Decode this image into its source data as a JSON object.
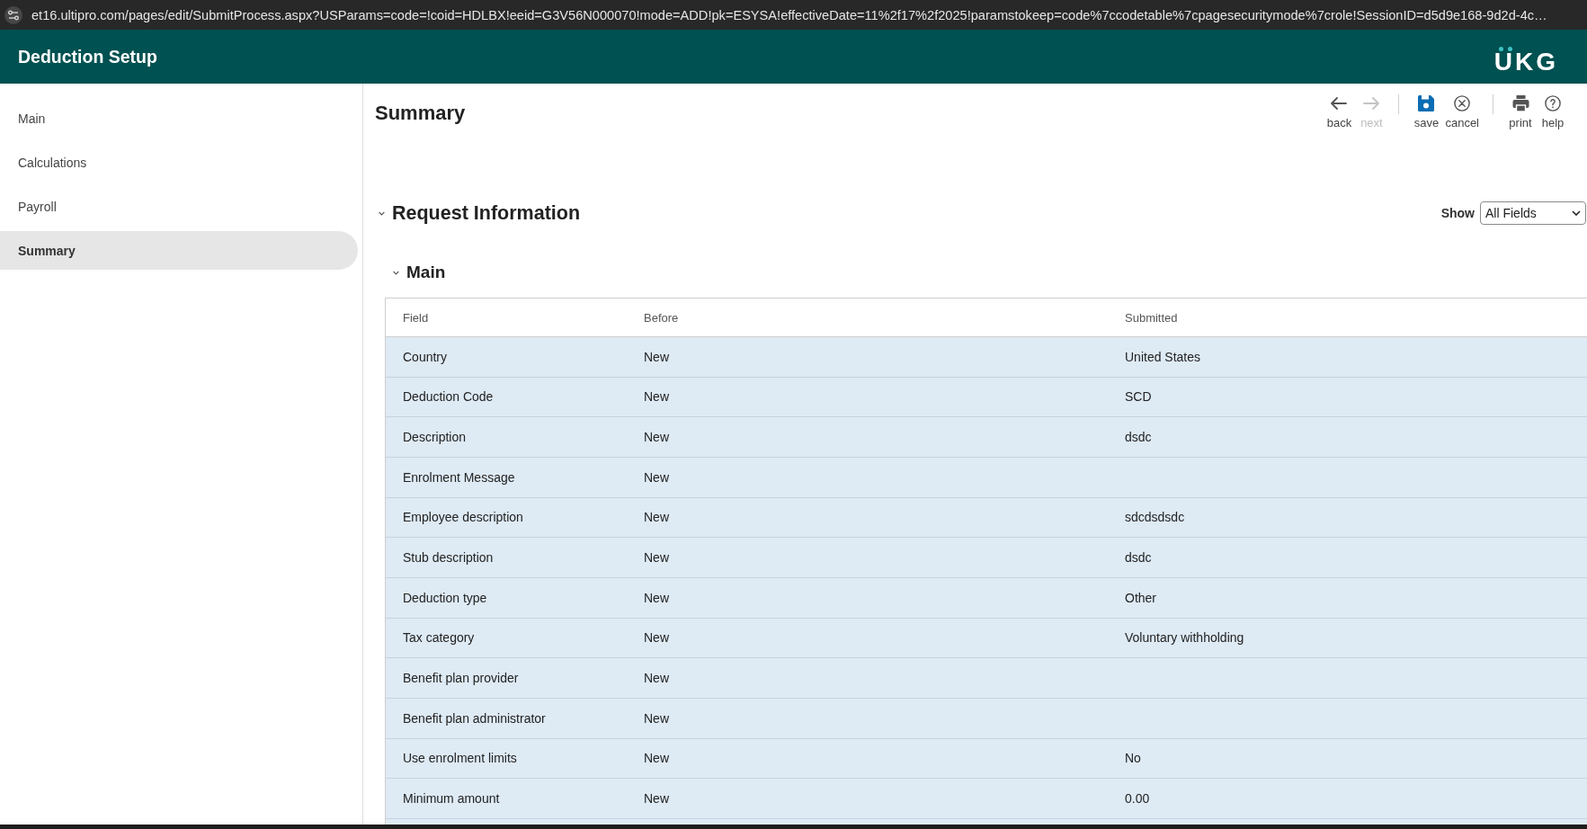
{
  "browser": {
    "url": "et16.ultipro.com/pages/edit/SubmitProcess.aspx?USParams=code=!coid=HDLBX!eeid=G3V56N000070!mode=ADD!pk=ESYSA!effectiveDate=11%2f17%2f2025!paramstokeep=code%7ccodetable%7cpagesecuritymode%7crole!SessionID=d5d9e168-9d2d-4c…"
  },
  "header": {
    "title": "Deduction Setup",
    "logo": "UKG"
  },
  "sidebar": {
    "items": [
      {
        "label": "Main",
        "selected": false
      },
      {
        "label": "Calculations",
        "selected": false
      },
      {
        "label": "Payroll",
        "selected": false
      },
      {
        "label": "Summary",
        "selected": true
      }
    ]
  },
  "page": {
    "title": "Summary",
    "toolbar": {
      "groups": [
        [
          {
            "kind": "back",
            "label": "back",
            "disabled": false
          },
          {
            "kind": "next",
            "label": "next",
            "disabled": true
          }
        ],
        [
          {
            "kind": "save",
            "label": "save",
            "disabled": false
          },
          {
            "kind": "cancel",
            "label": "cancel",
            "disabled": false
          }
        ],
        [
          {
            "kind": "print",
            "label": "print",
            "disabled": false
          },
          {
            "kind": "help",
            "label": "help",
            "disabled": false
          }
        ]
      ]
    }
  },
  "request_information": {
    "title": "Request Information",
    "expanded": true,
    "show_filter": {
      "label": "Show",
      "value": "All Fields"
    },
    "sections": [
      {
        "title": "Main",
        "expanded": true,
        "table": {
          "columns": [
            "Field",
            "Before",
            "Submitted"
          ],
          "rows": [
            {
              "field": "Country",
              "before": "New",
              "submitted": "United States"
            },
            {
              "field": "Deduction Code",
              "before": "New",
              "submitted": "SCD"
            },
            {
              "field": "Description",
              "before": "New",
              "submitted": "dsdc"
            },
            {
              "field": "Enrolment Message",
              "before": "New"
            },
            {
              "field": "Employee description",
              "before": "New",
              "submitted": "sdcdsdsdc"
            },
            {
              "field": "Stub description",
              "before": "New",
              "submitted": "dsdc"
            },
            {
              "field": "Deduction type",
              "before": "New",
              "submitted": "Other"
            },
            {
              "field": "Tax category",
              "before": "New",
              "submitted": "Voluntary withholding"
            },
            {
              "field": "Benefit plan provider",
              "before": "New"
            },
            {
              "field": "Benefit plan administrator",
              "before": "New"
            },
            {
              "field": "Use enrolment limits",
              "before": "New",
              "submitted": "No"
            },
            {
              "field": "Minimum amount",
              "before": "New",
              "submitted": "0.00"
            }
          ]
        }
      }
    ]
  }
}
